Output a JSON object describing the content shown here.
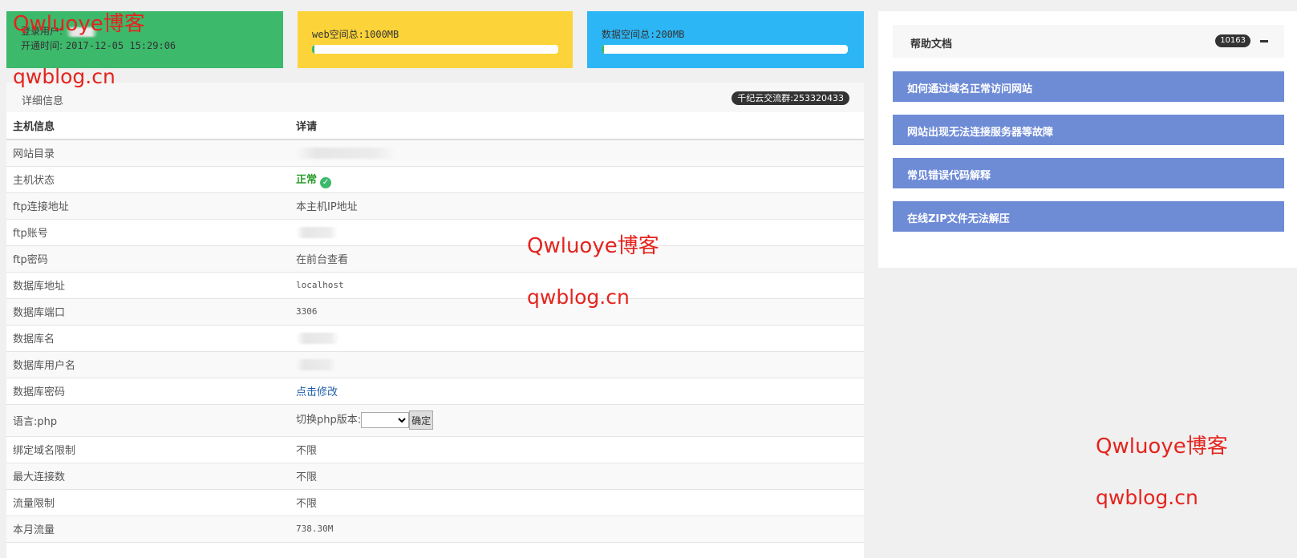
{
  "cards": {
    "user": {
      "login_label": "登录用户:",
      "opened_label": "开通时间:",
      "opened_value": "2017-12-05 15:29:06"
    },
    "web": {
      "label": "web空间总:1000MB",
      "usage_fraction": 0.01
    },
    "db": {
      "label": "数据空间总:200MB",
      "usage_fraction": 0.01
    }
  },
  "panel": {
    "title": "详细信息",
    "flow_badge": "千纪云交流群:253320433",
    "headers": [
      "主机信息",
      "详请"
    ],
    "rows": [
      {
        "label": "网站目录",
        "value": ""
      },
      {
        "label": "主机状态",
        "value": "正常"
      },
      {
        "label": "ftp连接地址",
        "value": "本主机IP地址"
      },
      {
        "label": "ftp账号",
        "value": ""
      },
      {
        "label": "ftp密码",
        "value": "在前台查看"
      },
      {
        "label": "数据库地址",
        "value": "localhost"
      },
      {
        "label": "数据库端口",
        "value": "3306"
      },
      {
        "label": "数据库名",
        "value": ""
      },
      {
        "label": "数据库用户名",
        "value": ""
      },
      {
        "label": "数据库密码",
        "value": "点击修改"
      },
      {
        "label": "语言:php",
        "value": "切换php版本:",
        "button": "确定"
      },
      {
        "label": "绑定域名限制",
        "value": "不限"
      },
      {
        "label": "最大连接数",
        "value": "不限"
      },
      {
        "label": "流量限制",
        "value": "不限"
      },
      {
        "label": "本月流量",
        "value": "738.30M"
      }
    ]
  },
  "help": {
    "title": "帮助文档",
    "count": "10163",
    "items": [
      "如何通过域名正常访问网站",
      "网站出现无法连接服务器等故障",
      "常见错误代码解释",
      "在线ZIP文件无法解压"
    ]
  },
  "watermarks": {
    "line1": "Qwluoye博客",
    "line2": "qwblog.cn"
  },
  "colors": {
    "green": "#3cb96b",
    "yellow": "#fcd439",
    "blue": "#2db6f5",
    "help_item": "#6e8bd6",
    "watermark": "#e4241e"
  }
}
